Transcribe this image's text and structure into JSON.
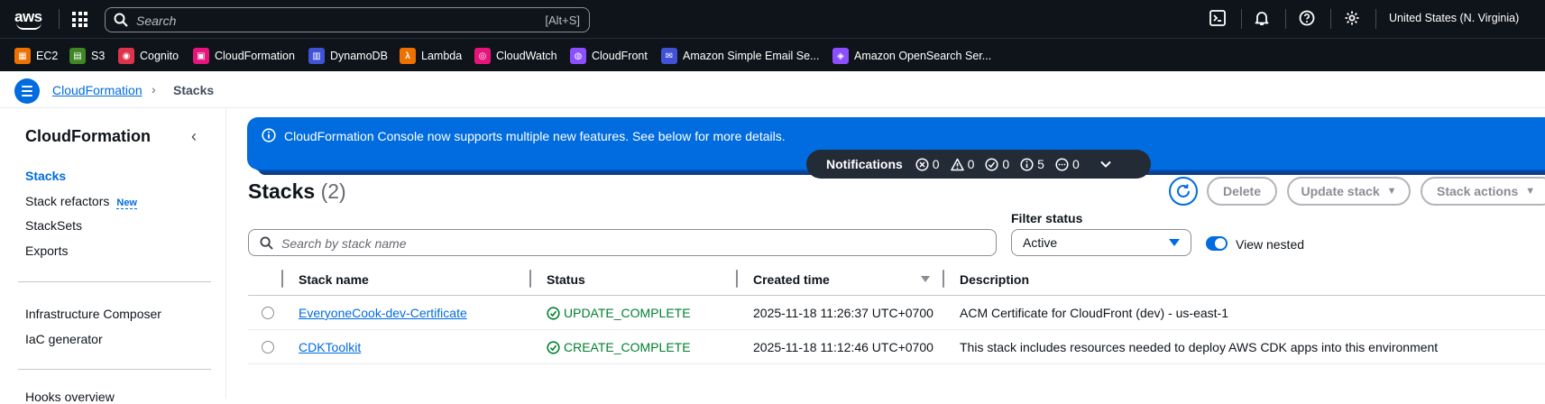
{
  "topnav": {
    "logo_text": "aws",
    "search_placeholder": "Search",
    "search_shortcut": "[Alt+S]",
    "region": "United States (N. Virginia)"
  },
  "favorites": [
    {
      "label": "EC2",
      "color": "#ed7100",
      "glyph": "▦"
    },
    {
      "label": "S3",
      "color": "#3f8624",
      "glyph": "▤"
    },
    {
      "label": "Cognito",
      "color": "#dd344c",
      "glyph": "◉"
    },
    {
      "label": "CloudFormation",
      "color": "#e7157b",
      "glyph": "▣"
    },
    {
      "label": "DynamoDB",
      "color": "#4053d6",
      "glyph": "▥"
    },
    {
      "label": "Lambda",
      "color": "#ed7100",
      "glyph": "λ"
    },
    {
      "label": "CloudWatch",
      "color": "#e7157b",
      "glyph": "◎"
    },
    {
      "label": "CloudFront",
      "color": "#8c4fff",
      "glyph": "◍"
    },
    {
      "label": "Amazon Simple Email Se...",
      "color": "#4053d6",
      "glyph": "✉"
    },
    {
      "label": "Amazon OpenSearch Ser...",
      "color": "#8c4fff",
      "glyph": "◈"
    }
  ],
  "breadcrumb": {
    "parent": "CloudFormation",
    "current": "Stacks"
  },
  "sidebar": {
    "title": "CloudFormation",
    "items": [
      {
        "label": "Stacks",
        "active": true
      },
      {
        "label": "Stack refactors",
        "badge": "New"
      },
      {
        "label": "StackSets"
      },
      {
        "label": "Exports"
      },
      {
        "label": "Infrastructure Composer"
      },
      {
        "label": "IaC generator"
      },
      {
        "label": "Hooks overview"
      }
    ]
  },
  "flash": {
    "message": "CloudFormation Console now supports multiple new features. See below for more details."
  },
  "notifications": {
    "label": "Notifications",
    "error": "0",
    "warning": "0",
    "success": "0",
    "info": "5",
    "in_progress": "0"
  },
  "stacks": {
    "title": "Stacks",
    "count": "(2)",
    "delete_label": "Delete",
    "update_label": "Update stack",
    "actions_label": "Stack actions",
    "filter_label": "Filter status",
    "filter_value": "Active",
    "view_nested_label": "View nested",
    "search_placeholder": "Search by stack name",
    "columns": {
      "name": "Stack name",
      "status": "Status",
      "created": "Created time",
      "description": "Description"
    },
    "rows": [
      {
        "name": "EveryoneCook-dev-Certificate",
        "status": "UPDATE_COMPLETE",
        "created": "2025-11-18 11:26:37 UTC+0700",
        "description": "ACM Certificate for CloudFront (dev) - us-east-1"
      },
      {
        "name": "CDKToolkit",
        "status": "CREATE_COMPLETE",
        "created": "2025-11-18 11:12:46 UTC+0700",
        "description": "This stack includes resources needed to deploy AWS CDK apps into this environment"
      }
    ]
  },
  "colors": {
    "nav_bg": "#0f141a",
    "accent": "#006ce0",
    "success": "#00802f"
  }
}
